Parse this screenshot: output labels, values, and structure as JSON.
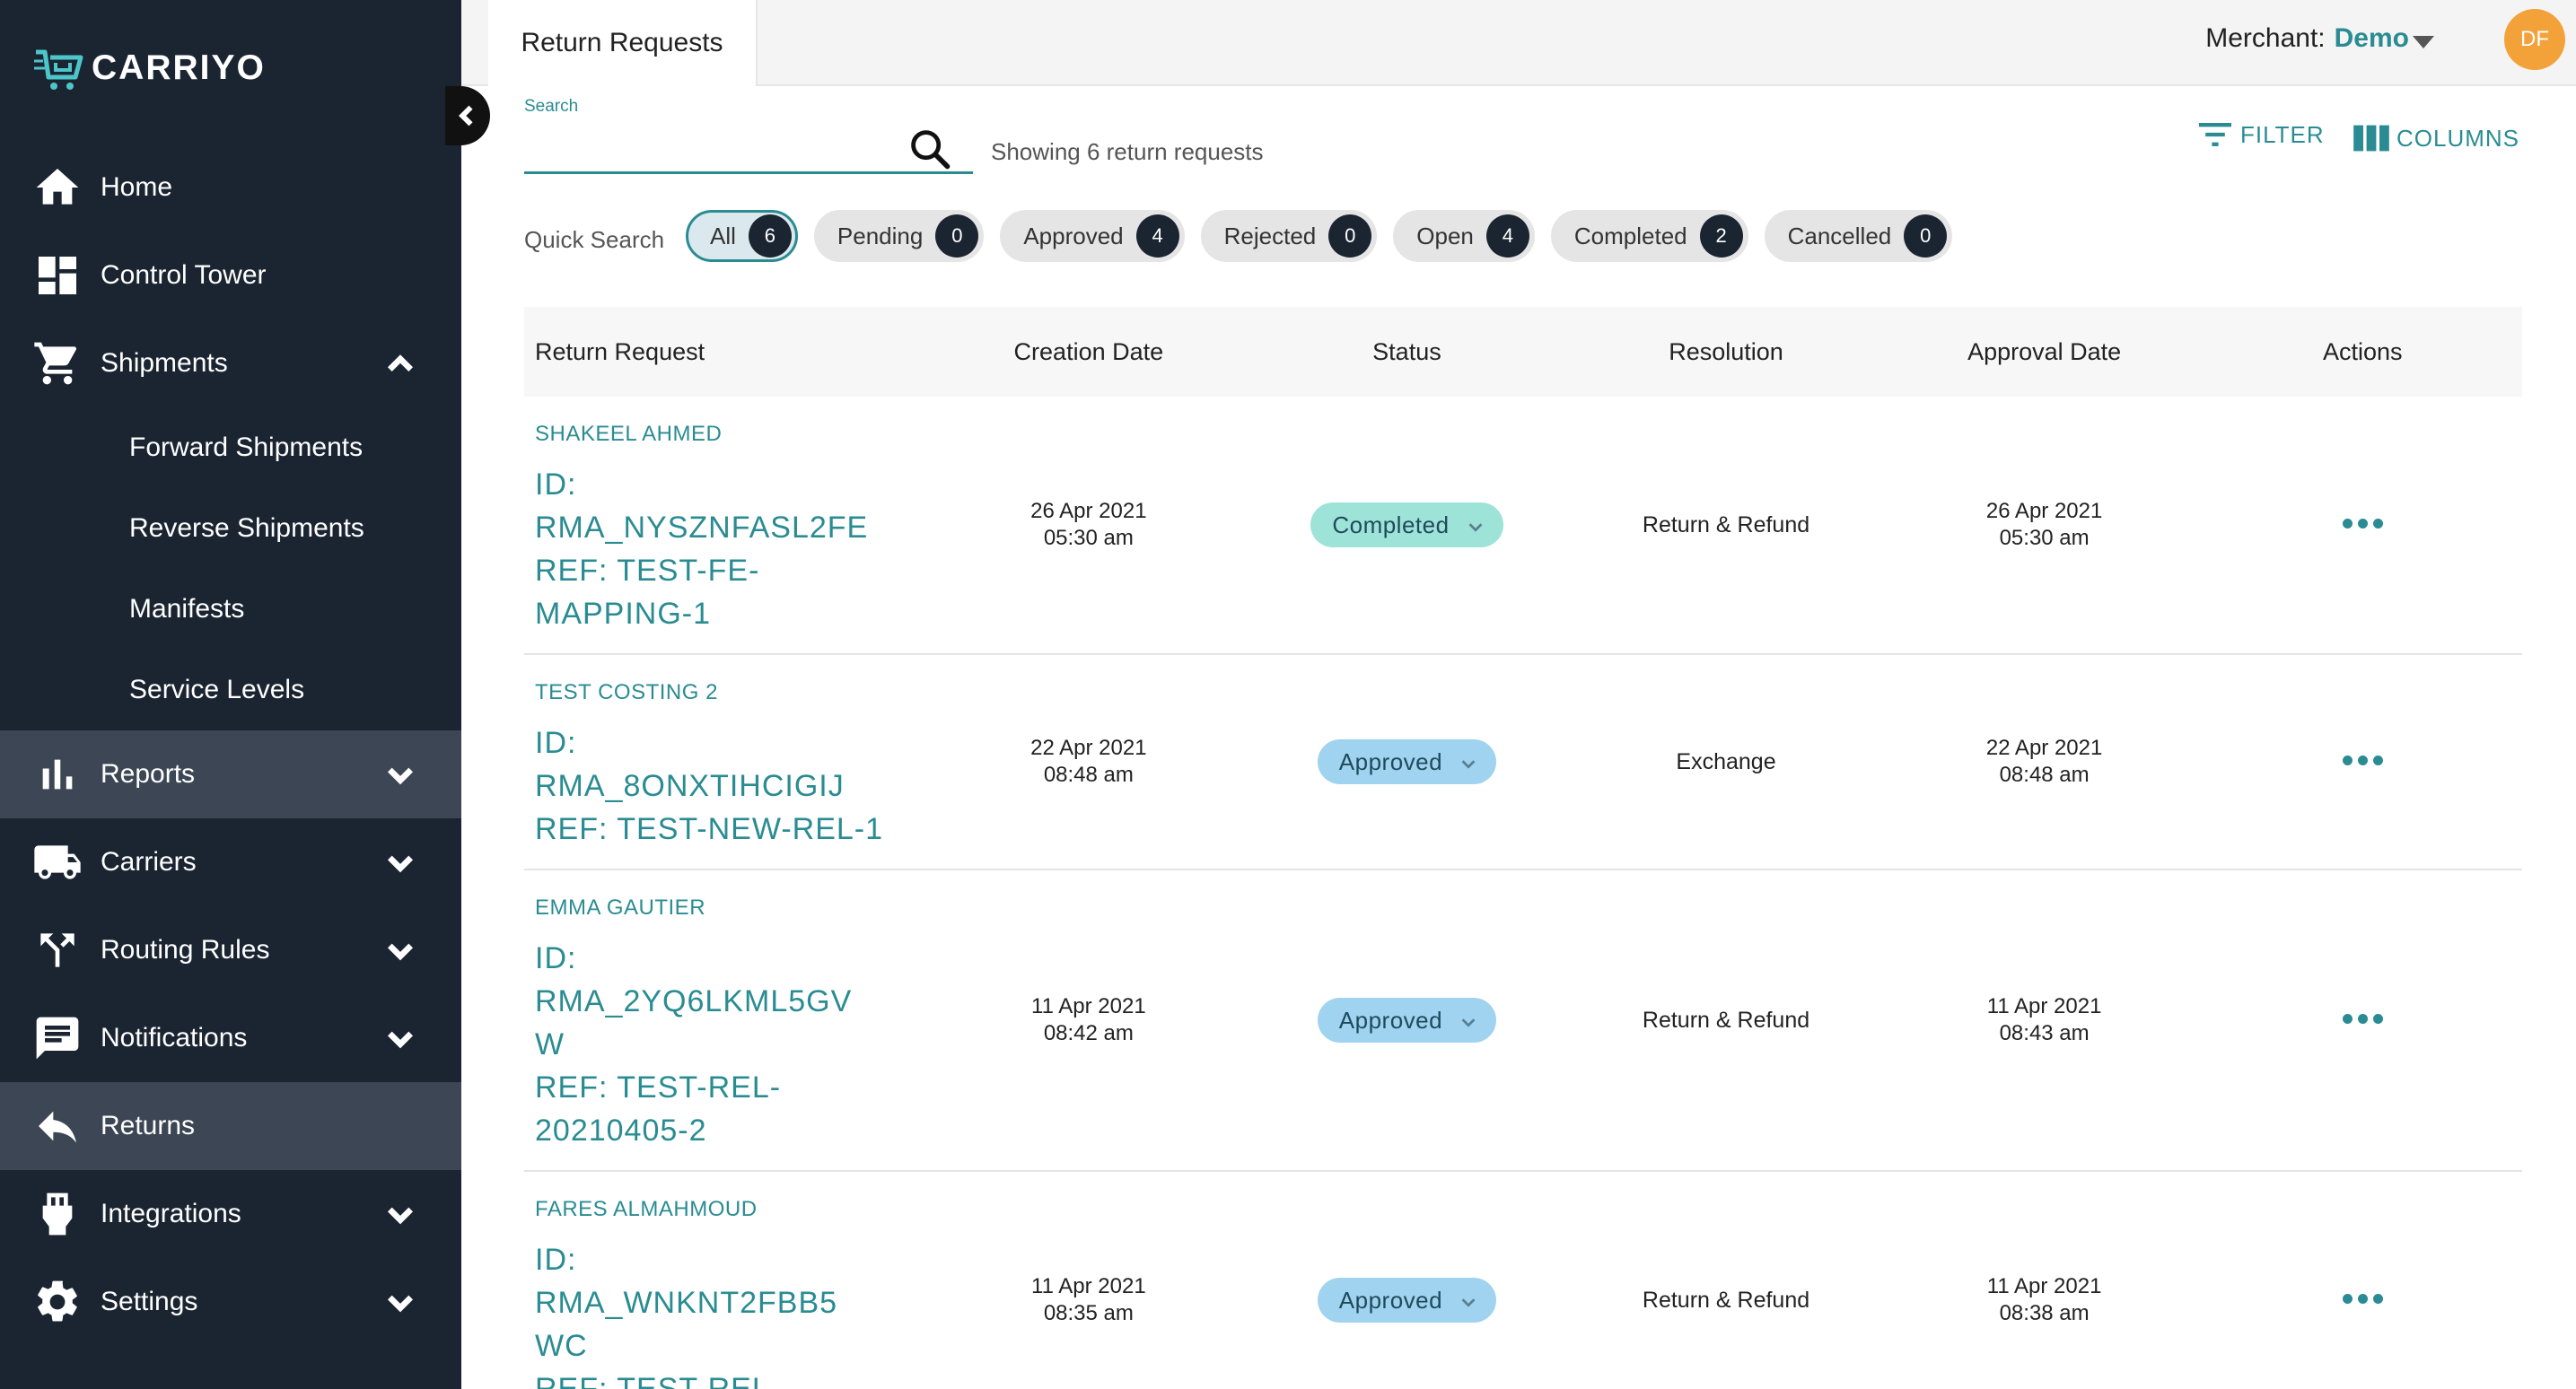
{
  "brand": {
    "name": "CARRIYO"
  },
  "sidebar": {
    "items": [
      {
        "label": "Home",
        "icon": "home-icon"
      },
      {
        "label": "Control Tower",
        "icon": "dashboard-icon"
      },
      {
        "label": "Shipments",
        "icon": "cart-icon",
        "expanded": true
      },
      {
        "label": "Forward Shipments"
      },
      {
        "label": "Reverse Shipments"
      },
      {
        "label": "Manifests"
      },
      {
        "label": "Service Levels"
      },
      {
        "label": "Reports",
        "icon": "bar-chart-icon"
      },
      {
        "label": "Carriers",
        "icon": "truck-icon"
      },
      {
        "label": "Routing Rules",
        "icon": "routing-icon"
      },
      {
        "label": "Notifications",
        "icon": "message-icon"
      },
      {
        "label": "Returns",
        "icon": "reply-icon",
        "active": true
      },
      {
        "label": "Integrations",
        "icon": "plug-icon"
      },
      {
        "label": "Settings",
        "icon": "gear-icon"
      }
    ]
  },
  "header": {
    "tab_title": "Return Requests",
    "merchant_label": "Merchant:",
    "merchant_value": "Demo",
    "avatar_initials": "DF"
  },
  "search": {
    "label": "Search",
    "value": "",
    "showing_text": "Showing 6 return requests"
  },
  "toolbar": {
    "filter_label": "FILTER",
    "columns_label": "COLUMNS"
  },
  "quick_search": {
    "label": "Quick Search",
    "chips": [
      {
        "label": "All",
        "count": "6",
        "selected": true
      },
      {
        "label": "Pending",
        "count": "0"
      },
      {
        "label": "Approved",
        "count": "4"
      },
      {
        "label": "Rejected",
        "count": "0"
      },
      {
        "label": "Open",
        "count": "4"
      },
      {
        "label": "Completed",
        "count": "2"
      },
      {
        "label": "Cancelled",
        "count": "0"
      }
    ]
  },
  "table": {
    "headers": [
      "Return Request",
      "Creation Date",
      "Status",
      "Resolution",
      "Approval Date",
      "Actions"
    ],
    "rows": [
      {
        "customer": "SHAKEEL AHMED",
        "id_lines": [
          "ID:",
          "RMA_NYSZNFASL2FE",
          "REF: TEST-FE-",
          "MAPPING-1"
        ],
        "created_date": "26 Apr 2021",
        "created_time": "05:30 am",
        "status": "Completed",
        "resolution": "Return & Refund",
        "approval_date": "26 Apr 2021",
        "approval_time": "05:30 am"
      },
      {
        "customer": "TEST COSTING 2",
        "id_lines": [
          "ID:",
          "RMA_8ONXTIHCIGIJ",
          "REF: TEST-NEW-REL-1"
        ],
        "created_date": "22 Apr 2021",
        "created_time": "08:48 am",
        "status": "Approved",
        "resolution": "Exchange",
        "approval_date": "22 Apr 2021",
        "approval_time": "08:48 am"
      },
      {
        "customer": "EMMA GAUTIER",
        "id_lines": [
          "ID:",
          "RMA_2YQ6LKML5GV",
          "W",
          "REF: TEST-REL-",
          "20210405-2"
        ],
        "created_date": "11 Apr 2021",
        "created_time": "08:42 am",
        "status": "Approved",
        "resolution": "Return & Refund",
        "approval_date": "11 Apr 2021",
        "approval_time": "08:43 am"
      },
      {
        "customer": "FARES ALMAHMOUD",
        "id_lines": [
          "ID:",
          "RMA_WNKNT2FBB5",
          "WC",
          "REF: TEST-REL-"
        ],
        "created_date": "11 Apr 2021",
        "created_time": "08:35 am",
        "status": "Approved",
        "resolution": "Return & Refund",
        "approval_date": "11 Apr 2021",
        "approval_time": "08:38 am"
      }
    ]
  },
  "colors": {
    "accent": "#2a8c92",
    "sidebar_bg": "#1b2532",
    "sidebar_active": "#3c4654",
    "completed_bg": "#9ee3d8",
    "approved_bg": "#9fd3ef",
    "avatar_bg": "#f3a23a"
  }
}
